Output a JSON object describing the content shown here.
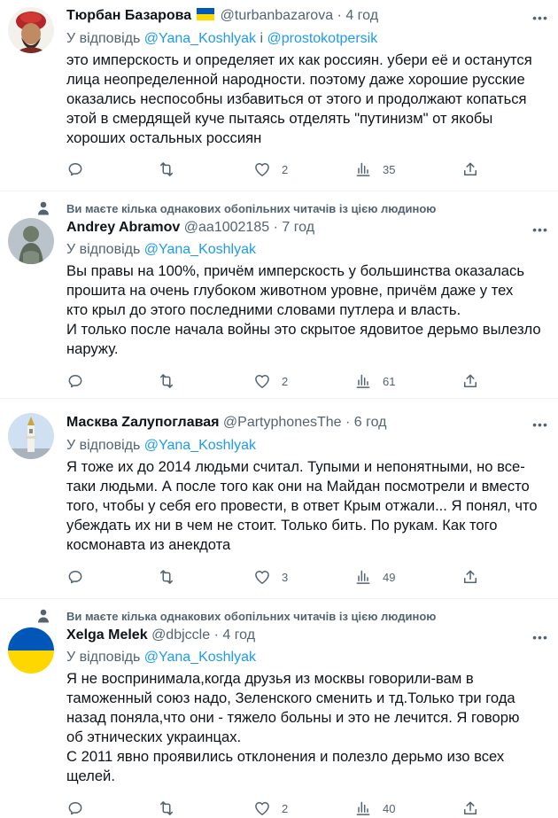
{
  "social_context_text": "Ви маєте кілька однакових обопільних читачів із цією людиною",
  "reply_prefix": "У відповідь",
  "reply_joiner": "і",
  "colors": {
    "link": "#1d9bf0",
    "secondary_text": "#536471",
    "divider": "#eff3f4",
    "ukraine_blue": "#0057b7",
    "ukraine_yellow": "#ffd700"
  },
  "icons": {
    "more": "more-dots-icon",
    "reply": "reply-bubble-icon",
    "retweet": "retweet-icon",
    "like": "heart-icon",
    "views": "views-bars-icon",
    "share": "share-upload-icon",
    "social": "person-icon"
  },
  "tweets": [
    {
      "name": "Тюрбан Базарова",
      "has_flag": true,
      "handle": "@turbanbazarova",
      "time": "4 год",
      "reply_to": [
        "@Yana_Koshlyak",
        "@prostokotpersik"
      ],
      "lines": [
        "это имперскость и определяет их как россиян. убери её и останутся",
        "лица неопределенной народности. поэтому даже хорошие русские",
        "оказались неспособны избавиться от этого и продолжают копаться",
        "этой в смердящей куче пытаясь отделять \"путинизм\" от якобы",
        "хороших остальных россиян"
      ],
      "stats": {
        "replies": "",
        "retweets": "",
        "likes": "2",
        "views": "35"
      }
    },
    {
      "name": "Andrey Abramov",
      "handle": "@aa1002185",
      "time": "7 год",
      "reply_to": [
        "@Yana_Koshlyak"
      ],
      "lines": [
        "Вы правы на 100%, причём имперскость у большинства оказалась",
        "прошита на очень глубоком животном уровне, причём даже у тех",
        "кто крыл до этого последними словами путлера и власть.",
        "И только после начала войны это скрытое ядовитое дерьмо вылезло",
        "наружу."
      ],
      "stats": {
        "replies": "",
        "retweets": "",
        "likes": "2",
        "views": "61"
      }
    },
    {
      "name": "Масква Zалупоглавая",
      "handle": "@PartyphonesThe",
      "time": "6 год",
      "reply_to": [
        "@Yana_Koshlyak"
      ],
      "lines": [
        "Я тоже их до 2014 людьми считал. Тупыми и непонятными, но все-",
        "таки людьми. А после того как они на Майдан посмотрели и вместо",
        "того, чтобы у себя его провести, в ответ Крым отжали... Я понял, что",
        "убеждать их ни в чем не стоит. Только бить. По рукам. Как того",
        "космонавта из анекдота"
      ],
      "stats": {
        "replies": "",
        "retweets": "",
        "likes": "3",
        "views": "49"
      }
    },
    {
      "name": "Xelga Melek",
      "handle": "@dbjccle",
      "time": "4 год",
      "reply_to": [
        "@Yana_Koshlyak"
      ],
      "lines": [
        "Я не воспринимала,когда друзья из москвы говорили-вам в",
        "таможенный союз надо, Зеленского сменить и тд.Только три года",
        "назад поняла,что они - тяжело больны и это не лечится. Я говорю",
        "об этнических украинцах.",
        "С 2011 явно проявились отклонения и полезло дерьмо изо всех",
        "щелей."
      ],
      "stats": {
        "replies": "",
        "retweets": "",
        "likes": "2",
        "views": "40"
      }
    }
  ]
}
